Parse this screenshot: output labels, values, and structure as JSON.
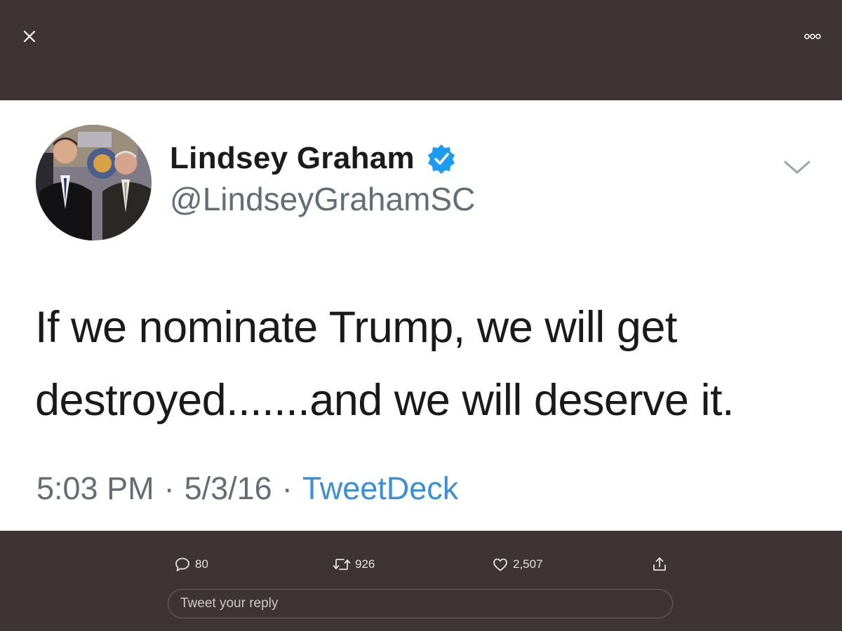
{
  "toolbar": {
    "close_icon": "close-icon",
    "more_icon": "more-options-icon"
  },
  "tweet": {
    "display_name": "Lindsey Graham",
    "verified": true,
    "handle": "@LindseyGrahamSC",
    "text_line1": "If we nominate Trump, we will get",
    "text_line2": "destroyed.......and we will deserve it.",
    "time": "5:03 PM",
    "separator": "·",
    "date": "5/3/16",
    "source": "TweetDeck"
  },
  "actions": {
    "reply_count": "80",
    "retweet_count": "926",
    "like_count": "2,507",
    "share_icon": "share-icon"
  },
  "reply": {
    "placeholder": "Tweet your reply"
  },
  "colors": {
    "background": "#3d3433",
    "card": "#ffffff",
    "verified_blue": "#1d9bf0",
    "link_blue": "#3a8fd6",
    "muted_text": "#636d76"
  }
}
